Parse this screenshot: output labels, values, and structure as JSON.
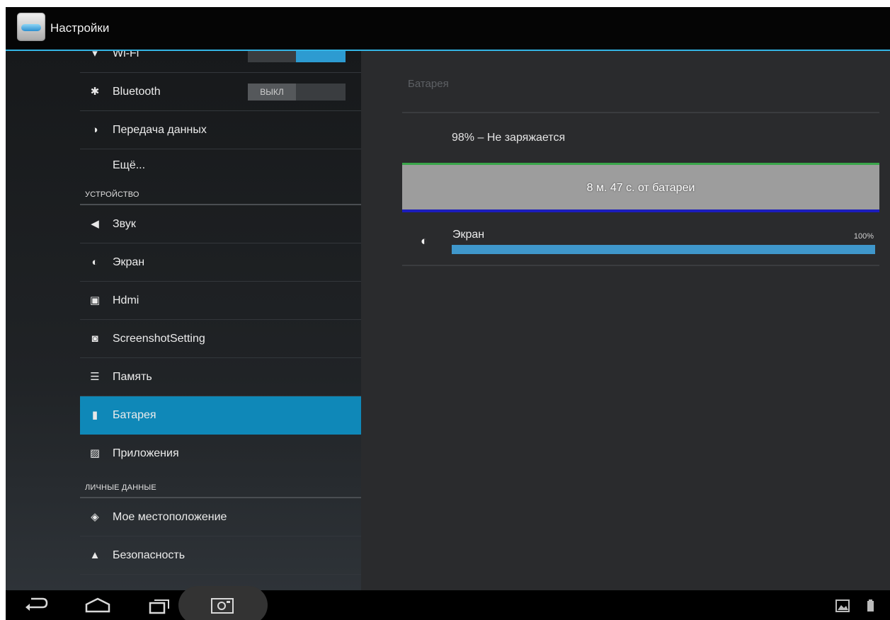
{
  "action_bar": {
    "title": "Настройки"
  },
  "settings_list": {
    "wifi_partial": "Wi-Fi",
    "bluetooth": {
      "label": "Bluetooth",
      "toggle": "ВЫКЛ"
    },
    "data_usage": "Передача данных",
    "more": "Ещё...",
    "device_header": "УСТРОЙСТВО",
    "device_items": [
      {
        "label": "Звук",
        "icon": "speaker-icon"
      },
      {
        "label": "Экран",
        "icon": "brightness-icon"
      },
      {
        "label": "Hdmi",
        "icon": "hdmi-icon"
      },
      {
        "label": "ScreenshotSetting",
        "icon": "camera-icon"
      },
      {
        "label": "Память",
        "icon": "storage-icon"
      },
      {
        "label": "Батарея",
        "icon": "battery-icon",
        "selected": true
      },
      {
        "label": "Приложения",
        "icon": "apps-icon"
      }
    ],
    "personal_header": "ЛИЧНЫЕ ДАННЫЕ",
    "personal_items": [
      {
        "label": "Мое местоположение",
        "icon": "location-icon"
      },
      {
        "label": "Безопасность",
        "icon": "lock-icon"
      }
    ]
  },
  "battery_pane": {
    "title": "Батарея",
    "status": "98% – Не заряжается",
    "graph_label": "8 м. 47 с. от батареи",
    "usage": [
      {
        "label": "Экран",
        "percent_text": "100%",
        "fraction": 1.0
      }
    ]
  },
  "colors": {
    "accent": "#33b5e5",
    "selected_row": "#0f88b8",
    "usage_bar": "#3f97cb",
    "graph_top_line": "#3aa64a",
    "graph_bottom_line": "#1c1dbb"
  }
}
